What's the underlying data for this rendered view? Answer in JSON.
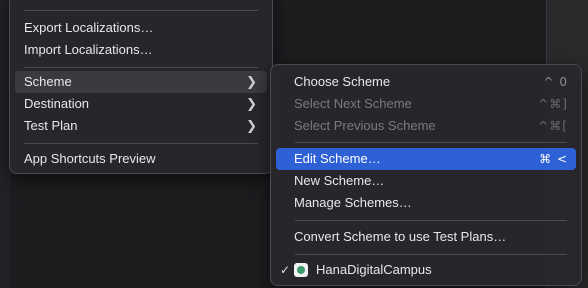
{
  "main_menu": {
    "items": [
      {
        "label": "Export Localizations…"
      },
      {
        "label": "Import Localizations…"
      },
      {
        "label": "Scheme"
      },
      {
        "label": "Destination"
      },
      {
        "label": "Test Plan"
      },
      {
        "label": "App Shortcuts Preview"
      }
    ],
    "submenu_icon": "chevron-right-icon"
  },
  "scheme_submenu": {
    "items": [
      {
        "label": "Choose Scheme",
        "shortcut": "^ 0",
        "enabled": true
      },
      {
        "label": "Select Next Scheme",
        "shortcut": "^⌘]",
        "enabled": false
      },
      {
        "label": "Select Previous Scheme",
        "shortcut": "^⌘[",
        "enabled": false
      },
      {
        "label": "Edit Scheme…",
        "shortcut": "⌘ <",
        "enabled": true,
        "highlighted": true
      },
      {
        "label": "New Scheme…",
        "enabled": true
      },
      {
        "label": "Manage Schemes…",
        "enabled": true
      },
      {
        "label": "Convert Scheme to use Test Plans…",
        "enabled": true
      },
      {
        "label": "HanaDigitalCampus",
        "checked": true,
        "icon": "app-target-icon"
      }
    ],
    "checkmark": "✓"
  },
  "colors": {
    "highlight": "#2f61d6",
    "menu_bg": "#28282c",
    "disabled_text": "#7a7a7e"
  }
}
